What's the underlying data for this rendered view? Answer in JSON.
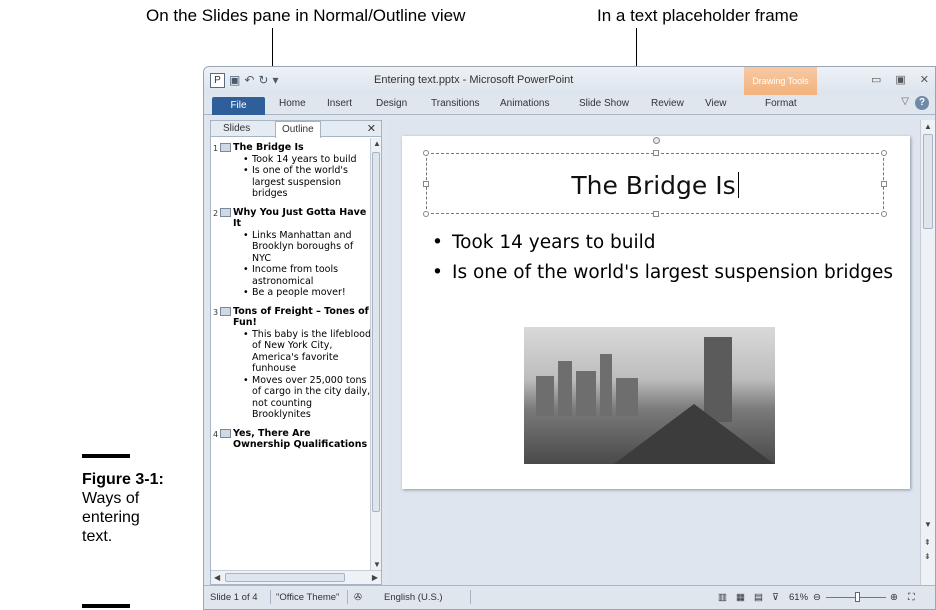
{
  "callouts": {
    "left": "On the Slides pane in Normal/Outline view",
    "right": "In a text placeholder frame"
  },
  "figure": {
    "number": "Figure 3-1:",
    "caption_lines": [
      "Ways of",
      "entering",
      "text."
    ]
  },
  "window": {
    "title": "Entering text.pptx - Microsoft PowerPoint",
    "context_tab": "Drawing Tools",
    "controls": [
      "▭",
      "▣",
      "✕"
    ]
  },
  "ribbon": {
    "tabs": [
      "File",
      "Home",
      "Insert",
      "Design",
      "Transitions",
      "Animations",
      "Slide Show",
      "Review",
      "View",
      "Format"
    ]
  },
  "pane": {
    "tabs": [
      "Slides",
      "Outline"
    ],
    "active_tab": "Outline",
    "close": "✕",
    "outline": [
      {
        "num": "1",
        "title": "The Bridge Is",
        "bullets": [
          "Took 14 years to build",
          "Is one of the world's largest suspension bridges"
        ]
      },
      {
        "num": "2",
        "title": "Why You Just Gotta Have It",
        "bullets": [
          "Links Manhattan and Brooklyn boroughs of NYC",
          "Income from tools astronomical",
          "Be a people mover!"
        ]
      },
      {
        "num": "3",
        "title": "Tons of Freight – Tones of Fun!",
        "bullets": [
          "This baby is the lifeblood of New York City, America's favorite funhouse",
          "Moves over 25,000 tons of cargo in the city daily, not counting Brooklynites"
        ]
      },
      {
        "num": "4",
        "title": "Yes, There Are Ownership Qualifications",
        "bullets": []
      }
    ]
  },
  "slide": {
    "title": "The Bridge Is",
    "bullets": [
      "Took 14 years to build",
      "Is one of the world's largest suspension bridges"
    ]
  },
  "status": {
    "slide_of": "Slide 1 of 4",
    "theme": "\"Office Theme\"",
    "language": "English (U.S.)",
    "zoom": "61%"
  }
}
